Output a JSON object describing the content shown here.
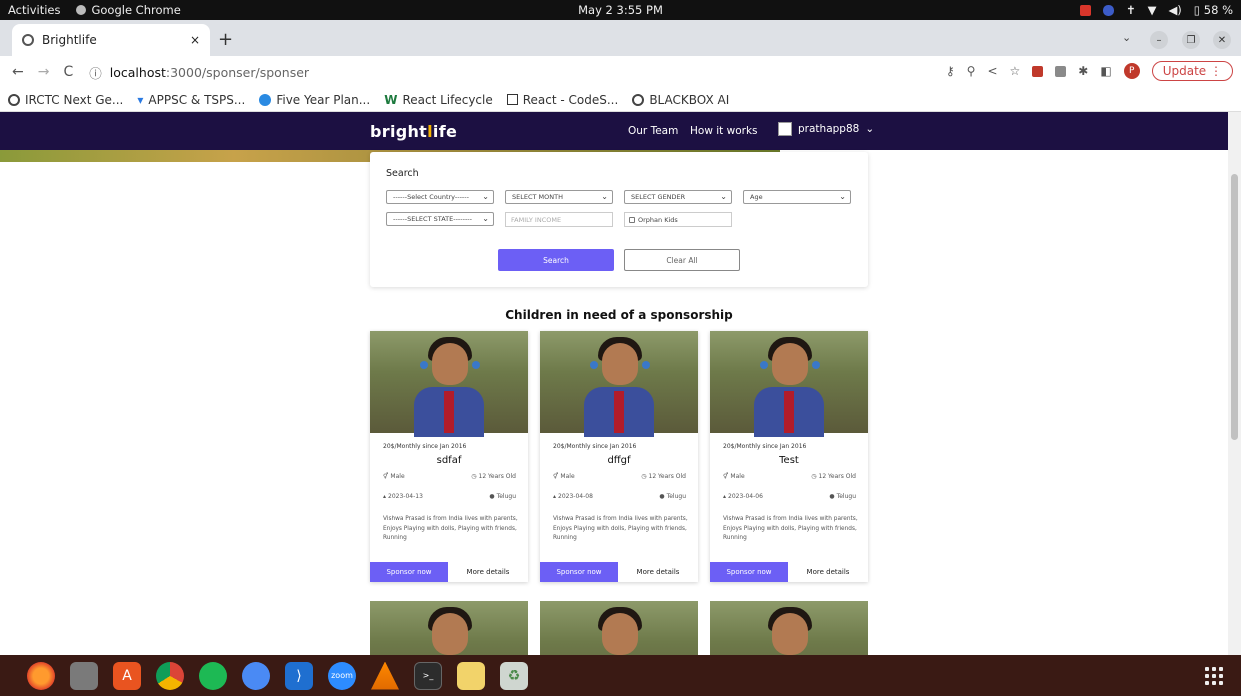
{
  "system_bar": {
    "activities": "Activities",
    "app_name": "Google Chrome",
    "clock": "May 2  3:55 PM",
    "battery": "58 %"
  },
  "browser": {
    "tab_title": "Brightlife",
    "tab_close": "×",
    "new_tab": "+",
    "url_host": "localhost",
    "url_path": ":3000/sponser/sponser",
    "update_label": "Update",
    "profile_initial": "P",
    "bookmarks": [
      "IRCTC Next Ge...",
      "APPSC & TSPS...",
      "Five Year Plan...",
      "React Lifecycle",
      "React - CodeS...",
      "BLACKBOX AI"
    ]
  },
  "site": {
    "logo_pre": "bright",
    "logo_i": "l",
    "logo_post": "ife",
    "nav_team": "Our Team",
    "nav_how": "How it works",
    "nav_user": "prathapp88",
    "nav_user_chevron": "⌄"
  },
  "search": {
    "label": "Search",
    "country": "------Select Country------",
    "month": "SELECT MONTH",
    "gender": "SELECT GENDER",
    "age": "Age",
    "state": "------SELECT STATE--------",
    "family_income_placeholder": "FAMILY INCOME",
    "orphan_label": "Orphan Kids",
    "search_button": "Search",
    "clear_button": "Clear All"
  },
  "section_title": "Children in need of a sponsorship",
  "cards": [
    {
      "monthly": "20$/Monthly since Jan 2016",
      "name": "sdfaf",
      "gender": "Male",
      "age": "12 Years Old",
      "date": "2023-04-13",
      "language": "Telugu",
      "description": "Vishwa Prasad is from India lives with parents, Enjoys Playing with dolls, Playing with friends, Running",
      "sponsor_label": "Sponsor now",
      "more_label": "More details"
    },
    {
      "monthly": "20$/Monthly since Jan 2016",
      "name": "dffgf",
      "gender": "Male",
      "age": "12 Years Old",
      "date": "2023-04-08",
      "language": "Telugu",
      "description": "Vishwa Prasad is from India lives with parents, Enjoys Playing with dolls, Playing with friends, Running",
      "sponsor_label": "Sponsor now",
      "more_label": "More details"
    },
    {
      "monthly": "20$/Monthly since Jan 2016",
      "name": "Test",
      "gender": "Male",
      "age": "12 Years Old",
      "date": "2023-04-06",
      "language": "Telugu",
      "description": "Vishwa Prasad is from India lives with parents, Enjoys Playing with dolls, Playing with friends, Running",
      "sponsor_label": "Sponsor now",
      "more_label": "More details"
    }
  ],
  "colors": {
    "site_nav_bg": "#1c1042",
    "accent": "#6c5ff5",
    "taskbar_bg": "#3a1a14"
  },
  "taskbar_apps": [
    "firefox-icon",
    "files-icon",
    "software-center-icon",
    "chrome-icon",
    "spotify-icon",
    "chromium-icon",
    "vscode-icon",
    "zoom-icon",
    "vlc-icon",
    "terminal-icon",
    "image-viewer-icon",
    "trash-icon"
  ],
  "taskbar_zoom_label": "zoom"
}
